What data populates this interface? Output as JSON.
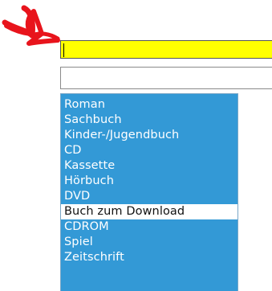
{
  "yellow_input": {
    "value": ""
  },
  "dropdown": {
    "selected_value": ""
  },
  "options": [
    {
      "label": "Roman",
      "selected": false
    },
    {
      "label": "Sachbuch",
      "selected": false
    },
    {
      "label": "Kinder-/Jugendbuch",
      "selected": false
    },
    {
      "label": "CD",
      "selected": false
    },
    {
      "label": "Kassette",
      "selected": false
    },
    {
      "label": "Hörbuch",
      "selected": false
    },
    {
      "label": "DVD",
      "selected": false
    },
    {
      "label": "Buch zum Download",
      "selected": true
    },
    {
      "label": "CDROM",
      "selected": false
    },
    {
      "label": "Spiel",
      "selected": false
    },
    {
      "label": "Zeitschrift",
      "selected": false
    }
  ],
  "colors": {
    "annotation_arrow": "#e8141c",
    "input_highlight": "#ffff00",
    "listbox_background": "#3399d6",
    "selected_option_background": "#ffffff"
  },
  "icons": {
    "annotation": "red-arrow-icon"
  }
}
